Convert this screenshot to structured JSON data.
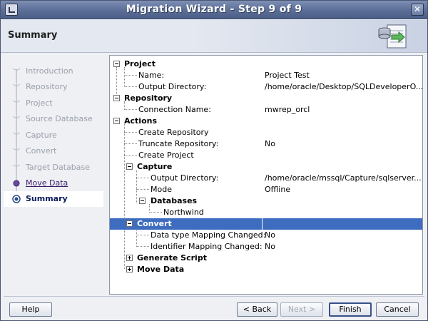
{
  "window": {
    "title": "Migration Wizard - Step 9 of 9",
    "close_label": "✕"
  },
  "header": {
    "title": "Summary",
    "graphic_icon": "database-migration-icon"
  },
  "steps": [
    {
      "label": "Introduction",
      "state": "disabled"
    },
    {
      "label": "Repository",
      "state": "disabled"
    },
    {
      "label": "Project",
      "state": "disabled"
    },
    {
      "label": "Source Database",
      "state": "disabled"
    },
    {
      "label": "Capture",
      "state": "disabled"
    },
    {
      "label": "Convert",
      "state": "disabled"
    },
    {
      "label": "Target Database",
      "state": "disabled"
    },
    {
      "label": "Move Data",
      "state": "link"
    },
    {
      "label": "Summary",
      "state": "current"
    }
  ],
  "tree": {
    "project": {
      "label": "Project",
      "name_label": "Name:",
      "name_value": "Project Test",
      "outdir_label": "Output Directory:",
      "outdir_value": "/home/oracle/Desktop/SQLDeveloperO..."
    },
    "repository": {
      "label": "Repository",
      "conn_label": "Connection Name:",
      "conn_value": "mwrep_orcl"
    },
    "actions": {
      "label": "Actions",
      "create_repo": "Create Repository",
      "truncate_label": "Truncate Repository:",
      "truncate_value": "No",
      "create_project": "Create Project",
      "capture": {
        "label": "Capture",
        "outdir_label": "Output Directory:",
        "outdir_value": "/home/oracle/mssql/Capture/sqlserver...",
        "mode_label": "Mode",
        "mode_value": "Offline",
        "databases_label": "Databases",
        "db_item": "Northwind"
      },
      "convert": {
        "label": "Convert",
        "dtype_label": "Data type Mapping Changed:",
        "dtype_value": "No",
        "ident_label": "Identifier Mapping Changed:",
        "ident_value": "No"
      },
      "generate_script": "Generate Script",
      "move_data": "Move Data"
    }
  },
  "buttons": {
    "help": "Help",
    "back": "< Back",
    "next": "Next >",
    "finish": "Finish",
    "cancel": "Cancel"
  },
  "colors": {
    "title_bar": "#5a6d96",
    "selection": "#3e6dbf",
    "link_step": "#3a1c6a"
  }
}
